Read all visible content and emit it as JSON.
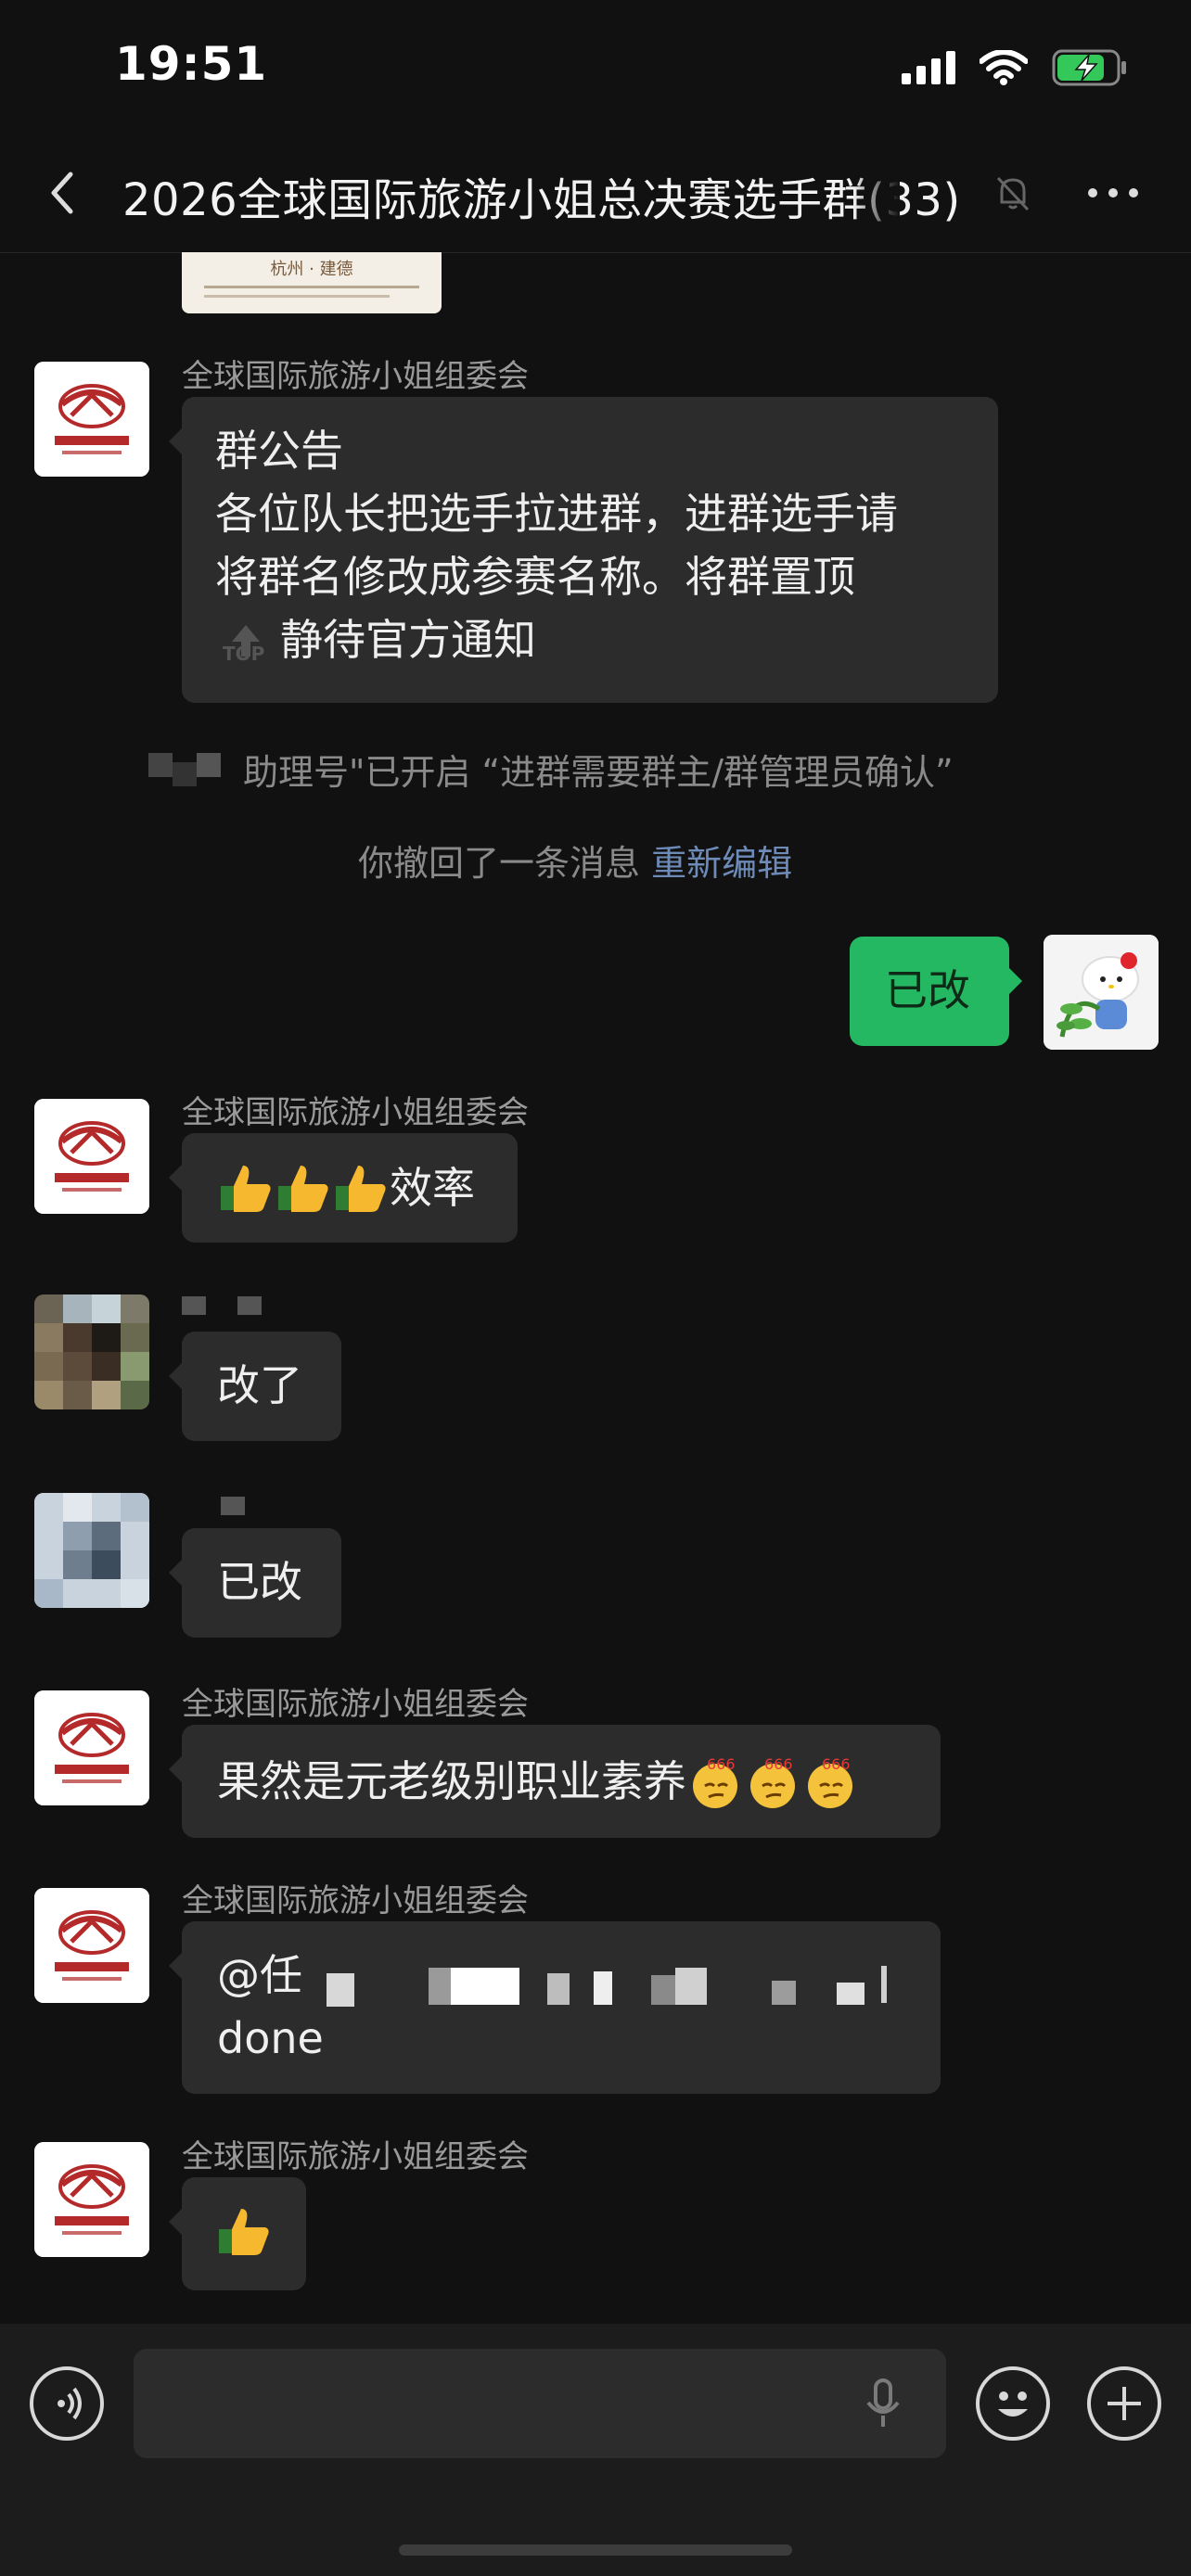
{
  "status_bar": {
    "time": "19:51"
  },
  "nav": {
    "title": "2026全球国际旅游小姐总决赛选手群(33)"
  },
  "poster_caption": "杭州 · 建德",
  "messages": [
    {
      "sender": "全球国际旅游小姐组委会",
      "announcement_label": "群公告",
      "text_line1": "各位队长把选手拉进群，进群选手请",
      "text_line2": "将群名修改成参赛名称。将群置顶",
      "text_line3": "静待官方通知",
      "top_label": "TOP"
    },
    {
      "system": "助理号\"已开启 “进群需要群主/群管理员确认”"
    },
    {
      "system": "你撤回了一条消息",
      "link": "重新编辑"
    },
    {
      "mine": true,
      "text": "已改"
    },
    {
      "sender": "全球国际旅游小姐组委会",
      "text": "效率"
    },
    {
      "text": "改了"
    },
    {
      "text": "已改"
    },
    {
      "sender": "全球国际旅游小姐组委会",
      "text": "果然是元老级别职业素养"
    },
    {
      "sender": "全球国际旅游小姐组委会",
      "text_line1": "@任",
      "text_line2": "done"
    },
    {
      "sender": "全球国际旅游小姐组委会"
    }
  ],
  "emoji_label": "666",
  "colors": {
    "background": "#111111",
    "bubble_other": "#2c2c2c",
    "bubble_mine": "#25b863",
    "link": "#6e8bb8"
  },
  "icons": [
    "back-icon",
    "mute-bell-icon",
    "more-icon",
    "voice-icon",
    "mic-icon",
    "emoji-icon",
    "plus-icon",
    "thumbs-up-icon",
    "signal-icon",
    "wifi-icon",
    "battery-icon"
  ]
}
